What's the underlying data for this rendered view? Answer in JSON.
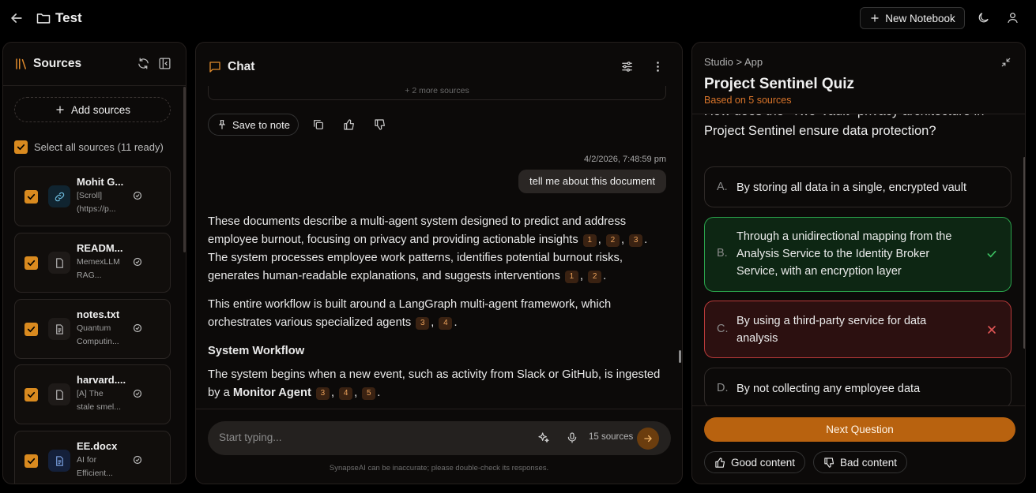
{
  "topbar": {
    "back_icon": "arrow-left-icon",
    "folder_icon": "folder-icon",
    "title": "Test",
    "new_notebook_label": "New Notebook"
  },
  "sources": {
    "title": "Sources",
    "add_label": "Add sources",
    "select_all_label": "Select all sources (11 ready)",
    "items": [
      {
        "name": "Mohit G...",
        "line1": "[Scroll]",
        "line2": "(https://p...",
        "icon": "link-icon"
      },
      {
        "name": "READM...",
        "line1": "MemexLLM",
        "line2": "RAG...",
        "icon": "file-icon"
      },
      {
        "name": "notes.txt",
        "line1": "Quantum",
        "line2": "Computin...",
        "icon": "file-text-icon"
      },
      {
        "name": "harvard....",
        "line1": "[A] The",
        "line2": "stale smel...",
        "icon": "file-icon"
      },
      {
        "name": "EE.docx",
        "line1": "AI for",
        "line2": "Efficient...",
        "icon": "docx-icon"
      }
    ]
  },
  "chat": {
    "title": "Chat",
    "more_sources": "+ 2 more sources",
    "save_note_label": "Save to note",
    "timestamp": "4/2/2026, 7:48:59 pm",
    "user_message": "tell me about this document",
    "p1_a": "These documents describe a multi-agent system designed to predict and address employee burnout, focusing on privacy and providing actionable insights",
    "p1_b": ". The system processes employee work patterns, identifies potential burnout risks, generates human-readable explanations, and suggests interventions",
    "p2": "This entire workflow is built around a LangGraph multi-agent framework, which orchestrates various specialized agents",
    "heading": "System Workflow",
    "p3_a": "The system begins when a new event, such as activity from Slack or GitHub, is ingested by a",
    "p3_bold": "Monitor Agent",
    "cites": [
      "1",
      "2",
      "3",
      "4",
      "5"
    ],
    "placeholder": "Start typing...",
    "source_count": "15 sources",
    "disclaimer": "SynapseAI can be inaccurate; please double-check its responses."
  },
  "studio": {
    "breadcrumb": "Studio > App",
    "quiz_title": "Project Sentinel Quiz",
    "based_on": "Based on 5 sources",
    "question": "How does the \"Two-Vault\" privacy architecture in Project Sentinel ensure data protection?",
    "options": [
      {
        "letter": "A.",
        "text": "By storing all data in a single, encrypted vault",
        "state": "neutral"
      },
      {
        "letter": "B.",
        "text": "Through a unidirectional mapping from the Analysis Service to the Identity Broker Service, with an encryption layer",
        "state": "correct"
      },
      {
        "letter": "C.",
        "text": "By using a third-party service for data analysis",
        "state": "wrong"
      },
      {
        "letter": "D.",
        "text": "By not collecting any employee data",
        "state": "neutral"
      }
    ],
    "next_label": "Next Question",
    "good_label": "Good content",
    "bad_label": "Bad content"
  },
  "colors": {
    "accent": "#d98a1f",
    "correct": "#2aa24b",
    "wrong": "#b93a3a"
  }
}
